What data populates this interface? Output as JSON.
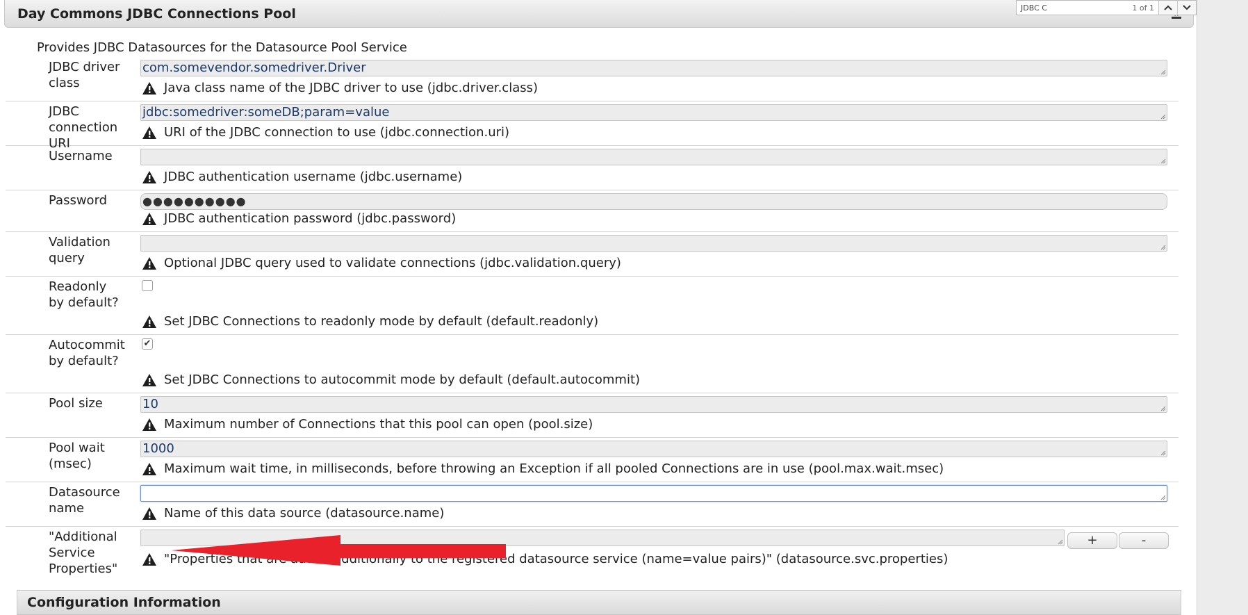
{
  "header": {
    "title": "Day Commons JDBC Connections Pool"
  },
  "findbar": {
    "query": "JDBC C",
    "count": "1 of 1"
  },
  "description": "Provides JDBC Datasources for the Datasource Pool Service",
  "fields": {
    "driver_class": {
      "label": "JDBC driver class",
      "value": "com.somevendor.somedriver.Driver",
      "hint": "Java class name of the JDBC driver to use (jdbc.driver.class)"
    },
    "connection_uri": {
      "label": "JDBC connection URI",
      "value": "jdbc:somedriver:someDB;param=value",
      "hint": "URI of the JDBC connection to use (jdbc.connection.uri)"
    },
    "username": {
      "label": "Username",
      "value": "",
      "hint": "JDBC authentication username (jdbc.username)"
    },
    "password": {
      "label": "Password",
      "value": "●●●●●●●●●●",
      "hint": "JDBC authentication password (jdbc.password)"
    },
    "validation_query": {
      "label": "Validation query",
      "value": "",
      "hint": "Optional JDBC query used to validate connections (jdbc.validation.query)"
    },
    "readonly": {
      "label": "Readonly by default?",
      "checked": false,
      "hint": "Set JDBC Connections to readonly mode by default (default.readonly)"
    },
    "autocommit": {
      "label": "Autocommit by default?",
      "checked": true,
      "check_mark": "✔",
      "hint": "Set JDBC Connections to autocommit mode by default (default.autocommit)"
    },
    "pool_size": {
      "label": "Pool size",
      "value": "10",
      "hint": "Maximum number of Connections that this pool can open (pool.size)"
    },
    "pool_wait": {
      "label": "Pool wait (msec)",
      "value": "1000",
      "hint": "Maximum wait time, in milliseconds, before throwing an Exception if all pooled Connections are in use (pool.max.wait.msec)"
    },
    "datasource_name": {
      "label": "Datasource name",
      "value": "",
      "hint": "Name of this data source (datasource.name)"
    },
    "additional_props": {
      "label": "\"Additional Service Properties\"",
      "value": "",
      "add_label": "+",
      "remove_label": "-",
      "hint": "\"Properties that are added additionally to the registered datasource service (name=value pairs)\" (datasource.svc.properties)"
    }
  },
  "footer_section": {
    "title": "Configuration Information"
  },
  "icons": {
    "warning": "warning-triangle-icon",
    "pin": "pin-icon",
    "find_prev": "chevron-up-icon",
    "find_next": "chevron-down-icon"
  },
  "colors": {
    "annotation_arrow": "#e8212a",
    "focus_border": "#6b8fd6"
  }
}
